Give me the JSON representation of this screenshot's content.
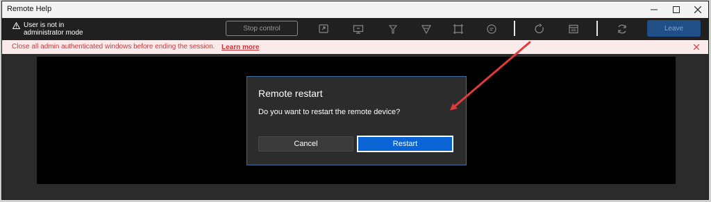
{
  "window": {
    "title": "Remote Help"
  },
  "toolbar": {
    "warning_line1": "User is not in",
    "warning_line2": "administrator mode",
    "stop_control_label": "Stop control",
    "leave_label": "Leave",
    "icons": [
      "screen-share-icon",
      "monitor-icon",
      "laser-pointer-icon",
      "highlighter-icon",
      "crop-icon",
      "chat-icon",
      "restart-icon",
      "task-manager-icon",
      "refresh-icon"
    ]
  },
  "banner": {
    "message": "Close all admin authenticated windows before ending the session.",
    "link_label": "Learn more"
  },
  "dialog": {
    "title": "Remote restart",
    "message": "Do you want to restart the remote device?",
    "cancel_label": "Cancel",
    "restart_label": "Restart"
  },
  "colors": {
    "annotation_arrow": "#e23a3a",
    "accent": "#0a64d6",
    "banner_text": "#d13438"
  }
}
